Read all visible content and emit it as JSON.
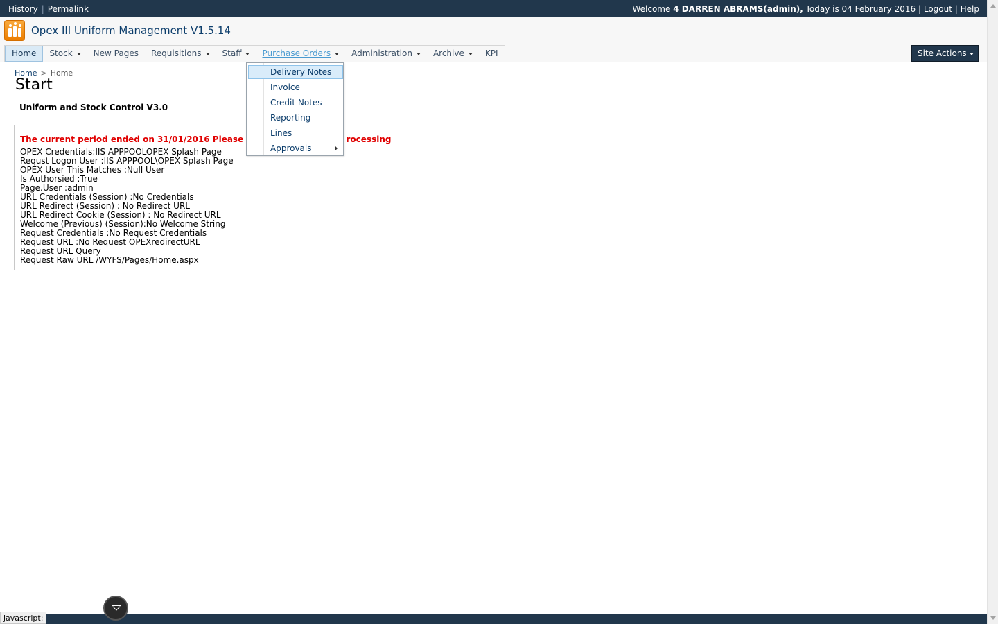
{
  "topbar": {
    "history": "History",
    "permalink": "Permalink",
    "welcome_prefix": "Welcome",
    "user_name": "4 DARREN ABRAMS(admin),",
    "date_text": "Today is 04 February 2016",
    "logout": "Logout",
    "help": "Help",
    "separator": "|"
  },
  "site": {
    "title": "Opex III Uniform Management V1.5.14"
  },
  "nav": {
    "items": [
      {
        "label": "Home"
      },
      {
        "label": "Stock"
      },
      {
        "label": "New Pages"
      },
      {
        "label": "Requisitions"
      },
      {
        "label": "Staff"
      },
      {
        "label": "Purchase Orders"
      },
      {
        "label": "Administration"
      },
      {
        "label": "Archive"
      },
      {
        "label": "KPI"
      }
    ],
    "site_actions": "Site Actions"
  },
  "dropdown": {
    "items": [
      {
        "label": "Delivery Notes"
      },
      {
        "label": "Invoice"
      },
      {
        "label": "Credit Notes"
      },
      {
        "label": "Reporting"
      },
      {
        "label": "Lines"
      },
      {
        "label": "Approvals"
      }
    ]
  },
  "breadcrumb": {
    "root": "Home",
    "arrow": ">",
    "current": "Home"
  },
  "page": {
    "title": "Start",
    "subtitle": "Uniform and Stock Control V3.0",
    "warning": "The current period ended on 31/01/2016 Please c",
    "warning_tail": "rocessing",
    "lines": [
      "OPEX Credentials:IIS APPPOOLOPEX Splash Page",
      "Requst Logon User :IIS APPPOOL\\OPEX Splash Page",
      "OPEX User This Matches :Null User",
      "Is Authorsied :True",
      "Page.User :admin",
      "URL Credentials (Session) :No Credentials",
      "URL Redirect (Session) : No Redirect URL",
      "URL Redirect Cookie (Session) : No Redirect URL",
      "Welcome (Previous) (Session):No Welcome String",
      "Request Credentials :No Request Credentials",
      "Request URL :No Request OPEXredirectURL",
      "Request URL Query",
      "Request Raw URL /WYFS/Pages/Home.aspx"
    ]
  },
  "status": {
    "text": "javascript:"
  },
  "colors": {
    "topbar": "#21374c",
    "warning": "#e00000",
    "link": "#0c3d6b",
    "hover_link": "#4a9bd1",
    "logo": "#ec7e00"
  }
}
